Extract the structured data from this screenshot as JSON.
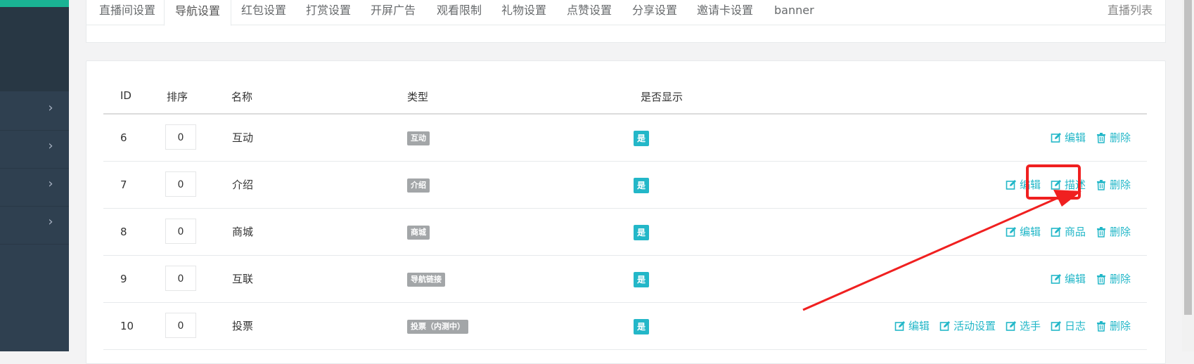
{
  "tabs": {
    "items": [
      {
        "label": "直播间设置"
      },
      {
        "label": "导航设置",
        "active": true
      },
      {
        "label": "红包设置"
      },
      {
        "label": "打赏设置"
      },
      {
        "label": "开屏广告"
      },
      {
        "label": "观看限制"
      },
      {
        "label": "礼物设置"
      },
      {
        "label": "点赞设置"
      },
      {
        "label": "分享设置"
      },
      {
        "label": "邀请卡设置"
      },
      {
        "label": "banner"
      }
    ],
    "right_link": "直播列表"
  },
  "table": {
    "headers": {
      "id": "ID",
      "sort": "排序",
      "name": "名称",
      "type": "类型",
      "show": "是否显示"
    },
    "rows": [
      {
        "id": "6",
        "sort": "0",
        "name": "互动",
        "type": "互动",
        "show": "是",
        "actions": [
          "编辑",
          "删除"
        ]
      },
      {
        "id": "7",
        "sort": "0",
        "name": "介绍",
        "type": "介绍",
        "show": "是",
        "actions": [
          "编辑",
          "描述",
          "删除"
        ]
      },
      {
        "id": "8",
        "sort": "0",
        "name": "商城",
        "type": "商城",
        "show": "是",
        "actions": [
          "编辑",
          "商品",
          "删除"
        ]
      },
      {
        "id": "9",
        "sort": "0",
        "name": "互联",
        "type": "导航链接",
        "show": "是",
        "actions": [
          "编辑",
          "删除"
        ]
      },
      {
        "id": "10",
        "sort": "0",
        "name": "投票",
        "type": "投票（内测中）",
        "show": "是",
        "actions": [
          "编辑",
          "活动设置",
          "选手",
          "日志",
          "删除"
        ]
      }
    ]
  },
  "colors": {
    "accent": "#23b7c8",
    "sidebar": "#2f4050",
    "badge_gray": "#a3a6a8",
    "annotation_red": "#f02020"
  },
  "icons": {
    "edit": "edit-icon",
    "delete": "trash-icon",
    "sidebar_chevron": "chevron-right-icon"
  }
}
